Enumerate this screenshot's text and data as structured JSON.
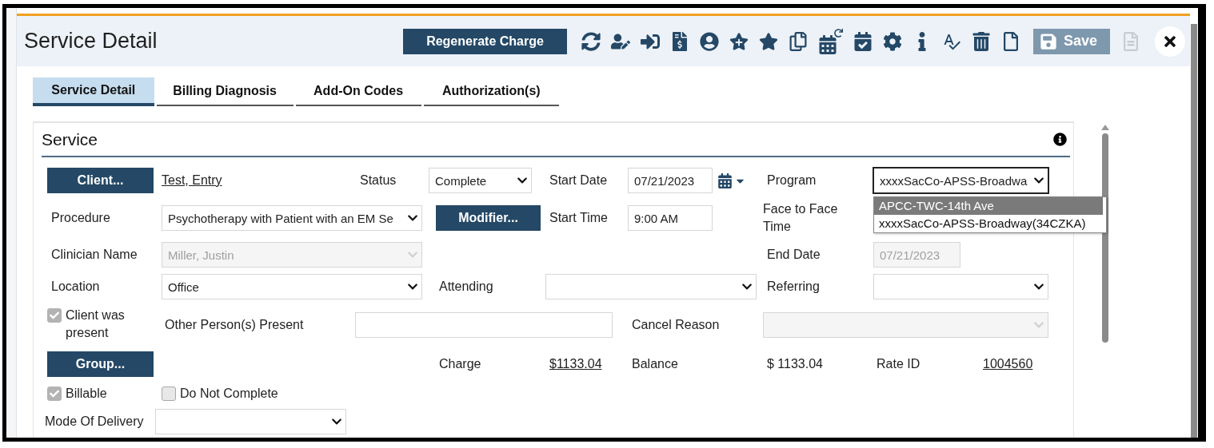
{
  "header": {
    "title": "Service Detail",
    "regenerate_button": "Regenerate Charge",
    "save_button": "Save"
  },
  "tabs": [
    {
      "label": "Service Detail",
      "selected": true
    },
    {
      "label": "Billing Diagnosis",
      "selected": false
    },
    {
      "label": "Add-On Codes",
      "selected": false
    },
    {
      "label": "Authorization(s)",
      "selected": false
    }
  ],
  "section": {
    "title": "Service"
  },
  "rows": [
    [
      {
        "kind": "button",
        "text": "Client..."
      },
      {
        "kind": "link",
        "text": "Test, Entry"
      },
      {
        "kind": "label",
        "text": "Status"
      },
      {
        "kind": "select",
        "value": "Complete",
        "disabled": false
      },
      {
        "kind": "label",
        "text": "Start Date"
      },
      {
        "kind": "date",
        "value": "07/21/2023"
      },
      {
        "kind": "label",
        "text": "Program"
      },
      {
        "kind": "select",
        "value": "xxxxSacCo-APSS-Broadwa",
        "disabled": false,
        "expanded": true,
        "options": [
          {
            "text": "APCC-TWC-14th Ave",
            "selected": true
          },
          {
            "text": "xxxxSacCo-APSS-Broadway(34CZKA)",
            "selected": false
          }
        ]
      }
    ],
    [
      {
        "kind": "label",
        "text": "Procedure"
      },
      {
        "kind": "select",
        "value": "Psychotherapy with Patient with an EM Se",
        "disabled": false
      },
      {
        "kind": "button",
        "text": "Modifier..."
      },
      {
        "kind": "label",
        "text": "Start Time"
      },
      {
        "kind": "input",
        "value": "9:00 AM",
        "disabled": false
      },
      {
        "kind": "label",
        "text": "Face to Face Time"
      }
    ],
    [
      {
        "kind": "label",
        "text": "Clinician Name"
      },
      {
        "kind": "select",
        "value": "Miller, Justin",
        "disabled": true
      },
      {
        "kind": "label",
        "text": "End Date"
      },
      {
        "kind": "input",
        "value": "07/21/2023",
        "disabled": true
      }
    ],
    [
      {
        "kind": "label",
        "text": "Location"
      },
      {
        "kind": "select",
        "value": "Office",
        "disabled": false
      },
      {
        "kind": "label",
        "text": "Attending"
      },
      {
        "kind": "select",
        "disabled": false
      },
      {
        "kind": "label",
        "text": "Referring"
      },
      {
        "kind": "select",
        "disabled": false
      }
    ],
    [
      {
        "kind": "checkbox",
        "text": "Client was present",
        "checked": true
      },
      {
        "kind": "label",
        "text": "Other Person(s) Present"
      },
      {
        "kind": "input"
      },
      {
        "kind": "label",
        "text": "Cancel Reason"
      },
      {
        "kind": "select",
        "disabled": true
      }
    ],
    [
      {
        "kind": "button",
        "text": "Group..."
      },
      {
        "kind": "label",
        "text": "Charge"
      },
      {
        "kind": "link",
        "text": "$1133.04"
      },
      {
        "kind": "label",
        "text": "Balance"
      },
      {
        "kind": "label",
        "text": "$ 1133.04"
      },
      {
        "kind": "label",
        "text": "Rate ID"
      },
      {
        "kind": "link",
        "text": "1004560"
      }
    ],
    [
      {
        "kind": "checkbox",
        "text": "Billable",
        "checked": true
      },
      {
        "kind": "checkbox",
        "text": "Do Not Complete",
        "checked": false
      }
    ],
    [
      {
        "kind": "label",
        "text": "Mode Of Delivery"
      },
      {
        "kind": "select",
        "disabled": false
      }
    ]
  ]
}
